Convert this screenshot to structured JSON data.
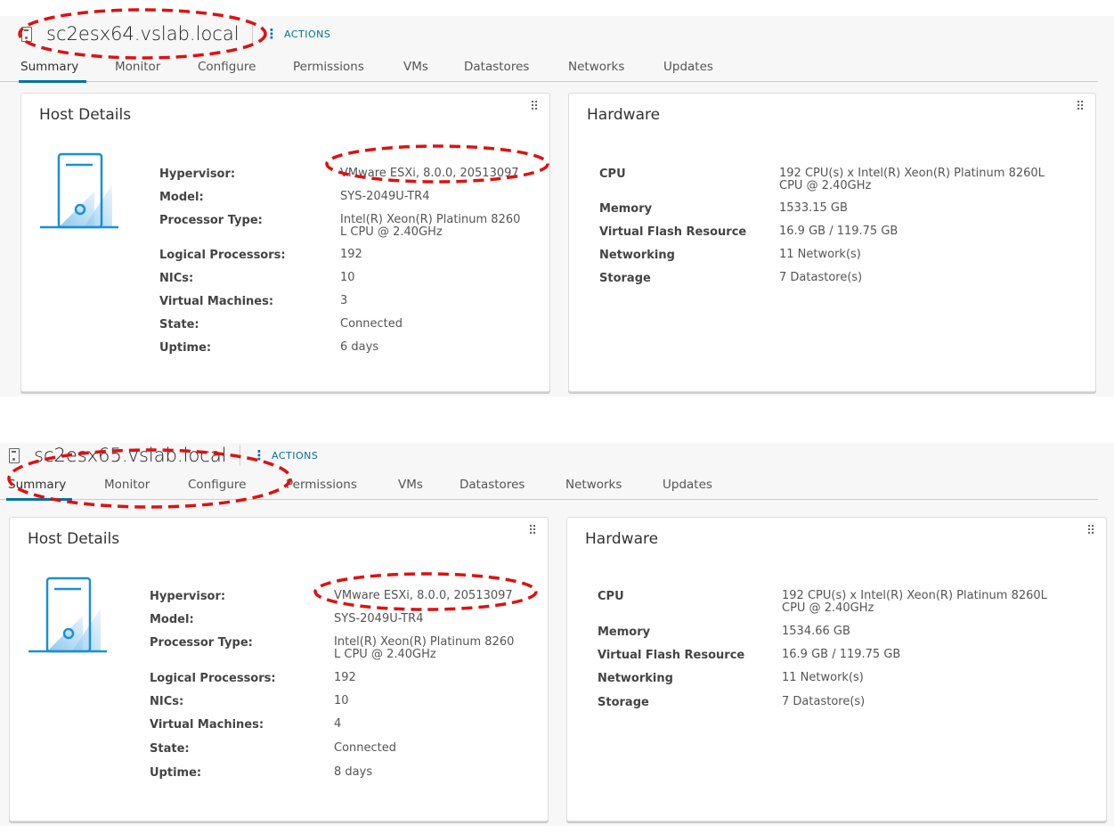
{
  "hosts": [
    {
      "title": "sc2esx64.vslab.local",
      "actions_label": "ACTIONS",
      "tabs": [
        "Summary",
        "Monitor",
        "Configure",
        "Permissions",
        "VMs",
        "Datastores",
        "Networks",
        "Updates"
      ],
      "active_tab": "Summary",
      "host_details": {
        "heading": "Host Details",
        "rows": [
          {
            "label": "Hypervisor:",
            "value": "VMware ESXi, 8.0.0, 20513097"
          },
          {
            "label": "Model:",
            "value": "SYS-2049U-TR4"
          },
          {
            "label": "Processor Type:",
            "value": "Intel(R) Xeon(R) Platinum 8260",
            "value2": "L CPU @ 2.40GHz"
          },
          {
            "label": "Logical Processors:",
            "value": "192"
          },
          {
            "label": "NICs:",
            "value": "10"
          },
          {
            "label": "Virtual Machines:",
            "value": "3"
          },
          {
            "label": "State:",
            "value": "Connected"
          },
          {
            "label": "Uptime:",
            "value": "6 days"
          }
        ]
      },
      "hardware": {
        "heading": "Hardware",
        "rows": [
          {
            "label": "CPU",
            "value": "192 CPU(s) x Intel(R) Xeon(R) Platinum 8260L",
            "value2": "CPU @ 2.40GHz"
          },
          {
            "label": "Memory",
            "value": "1533.15 GB"
          },
          {
            "label": "Virtual Flash Resource",
            "value": "16.9 GB / 119.75 GB"
          },
          {
            "label": "Networking",
            "value": "11 Network(s)"
          },
          {
            "label": "Storage",
            "value": "7 Datastore(s)"
          }
        ]
      }
    },
    {
      "title": "sc2esx65.vslab.local",
      "actions_label": "ACTIONS",
      "tabs": [
        "Summary",
        "Monitor",
        "Configure",
        "Permissions",
        "VMs",
        "Datastores",
        "Networks",
        "Updates"
      ],
      "active_tab": "Summary",
      "host_details": {
        "heading": "Host Details",
        "rows": [
          {
            "label": "Hypervisor:",
            "value": "VMware ESXi, 8.0.0, 20513097"
          },
          {
            "label": "Model:",
            "value": "SYS-2049U-TR4"
          },
          {
            "label": "Processor Type:",
            "value": "Intel(R) Xeon(R) Platinum 8260",
            "value2": "L CPU @ 2.40GHz"
          },
          {
            "label": "Logical Processors:",
            "value": "192"
          },
          {
            "label": "NICs:",
            "value": "10"
          },
          {
            "label": "Virtual Machines:",
            "value": "4"
          },
          {
            "label": "State:",
            "value": "Connected"
          },
          {
            "label": "Uptime:",
            "value": "8 days"
          }
        ]
      },
      "hardware": {
        "heading": "Hardware",
        "rows": [
          {
            "label": "CPU",
            "value": "192 CPU(s) x Intel(R) Xeon(R) Platinum 8260L",
            "value2": "CPU @ 2.40GHz"
          },
          {
            "label": "Memory",
            "value": "1534.66 GB"
          },
          {
            "label": "Virtual Flash Resource",
            "value": "16.9 GB / 119.75 GB"
          },
          {
            "label": "Networking",
            "value": "11 Network(s)"
          },
          {
            "label": "Storage",
            "value": "7 Datastore(s)"
          }
        ]
      }
    }
  ],
  "colors": {
    "accent": "#0072a3",
    "annotation": "#e01010",
    "server_icon": "#1a8fd6"
  }
}
